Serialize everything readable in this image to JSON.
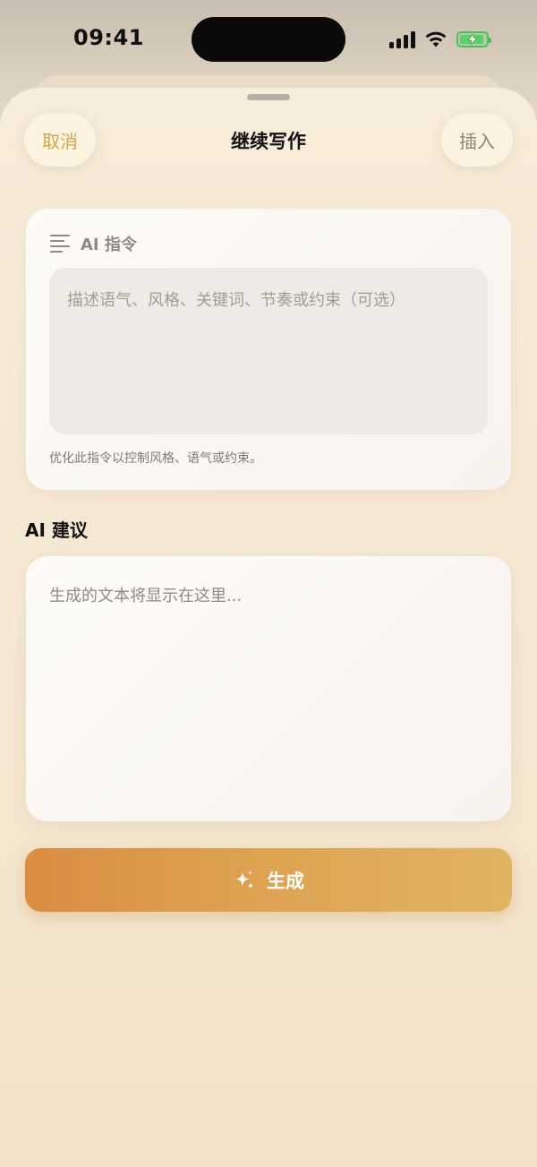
{
  "status_bar": {
    "time": "09:41"
  },
  "nav": {
    "cancel_label": "取消",
    "title": "继续写作",
    "insert_label": "插入"
  },
  "instruction": {
    "header_label": "AI 指令",
    "placeholder": "描述语气、风格、关键词、节奏或约束（可选）",
    "value": "",
    "hint": "优化此指令以控制风格、语气或约束。"
  },
  "suggestion": {
    "section_label": "AI 建议",
    "placeholder_text": "生成的文本将显示在这里..."
  },
  "generate": {
    "label": "生成"
  },
  "colors": {
    "accent": "#D4A54A",
    "button_gradient_start": "#D98D43",
    "button_gradient_end": "#E0B462",
    "battery": "#49C15A"
  },
  "icons": {
    "cellular": "signal-bars-icon",
    "wifi": "wifi-icon",
    "battery": "battery-charging-icon",
    "instruction": "text-lines-icon",
    "generate": "sparkle-icon"
  }
}
